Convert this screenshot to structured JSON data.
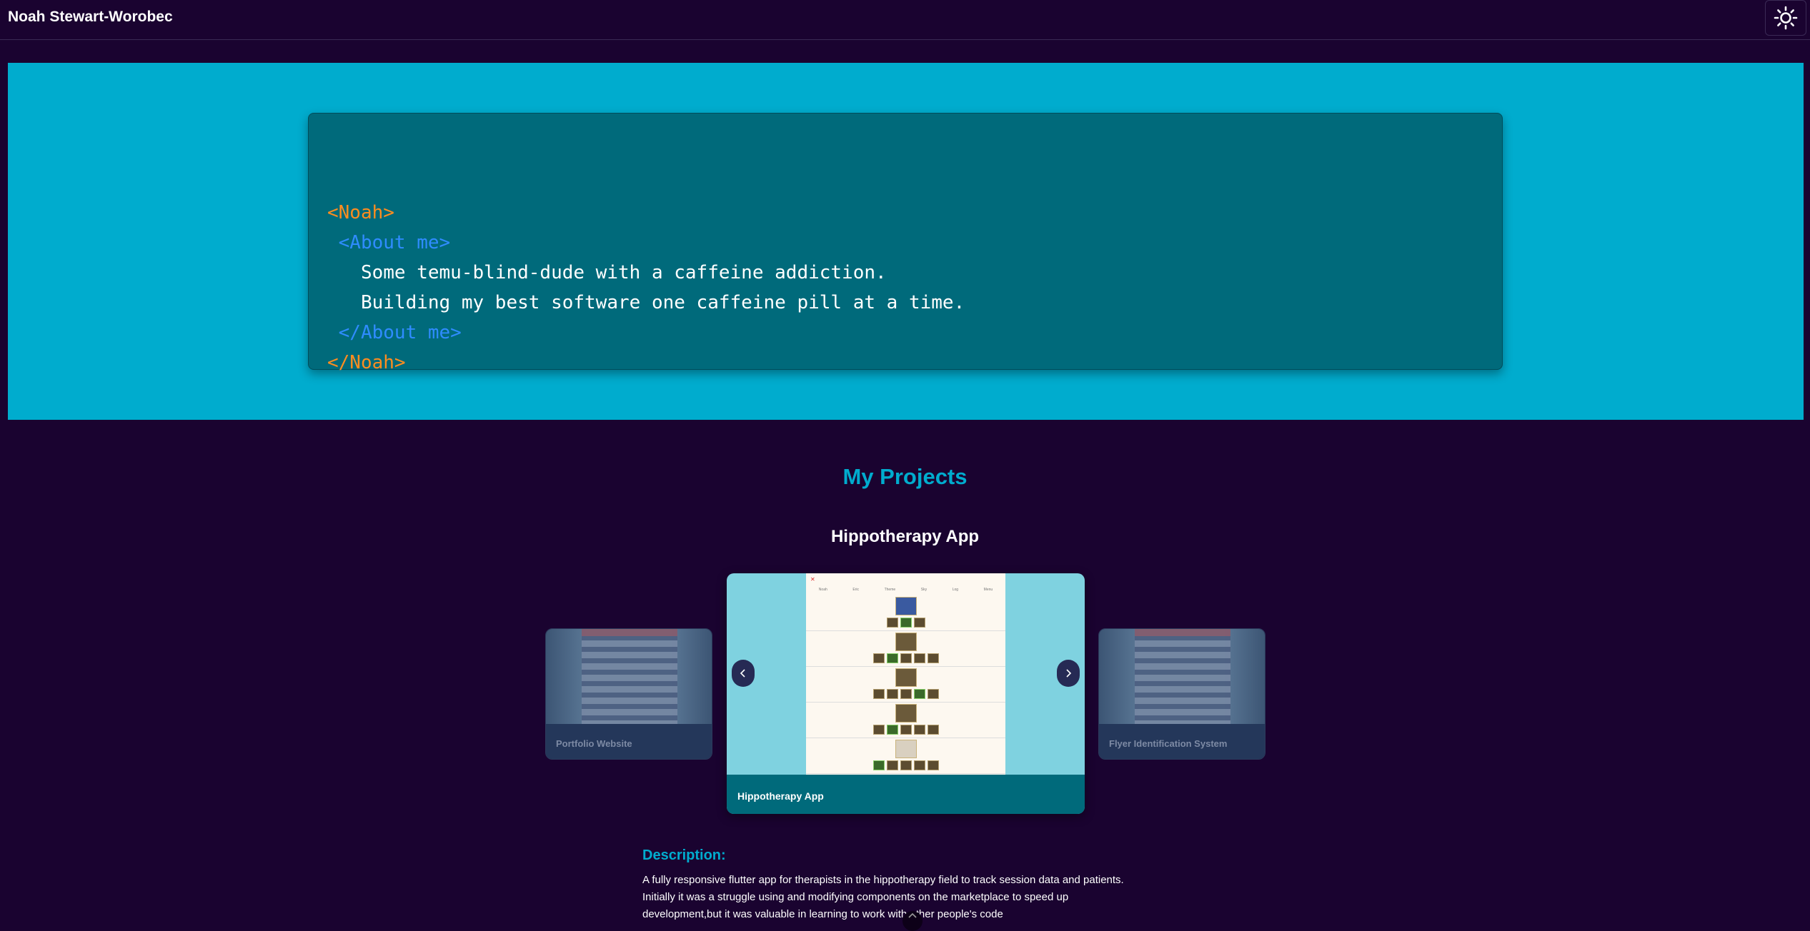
{
  "header": {
    "site_title": "Noah Stewart-Worobec",
    "theme_toggle_icon": "sun-icon"
  },
  "hero": {
    "code_lines": [
      {
        "text": "<Noah>",
        "kind": "noah-tag"
      },
      {
        "text": " <About me>",
        "kind": "about-tag"
      },
      {
        "text": "   Some temu-blind-dude with a caffeine addiction.",
        "kind": "text"
      },
      {
        "text": "   Building my best software one caffeine pill at a time.",
        "kind": "text"
      },
      {
        "text": " </About me>",
        "kind": "about-tag"
      },
      {
        "text": "</Noah>",
        "kind": "noah-tag"
      }
    ],
    "colors": {
      "noah_tag": "#ff8d1f",
      "about_tag": "#2f8cff",
      "background": "#00acce",
      "card": "#006a7b"
    }
  },
  "projects": {
    "heading": "My Projects",
    "current_title": "Hippotherapy App",
    "carousel": {
      "prev_card": "Portfolio Website",
      "current_card": "Hippotherapy App",
      "next_card": "Flyer Identification System",
      "prev_button_icon": "chevron-left-icon",
      "next_button_icon": "chevron-right-icon"
    },
    "description_heading": "Description:",
    "description_lines": [
      "A fully responsive flutter app for therapists in the hippotherapy field to track session data and patients.",
      "Initially it was a struggle using and modifying components on the marketplace to speed up",
      "development,but it was valuable in learning to work with other people's code"
    ]
  },
  "scroll_button_icon": "chevron-up-icon"
}
